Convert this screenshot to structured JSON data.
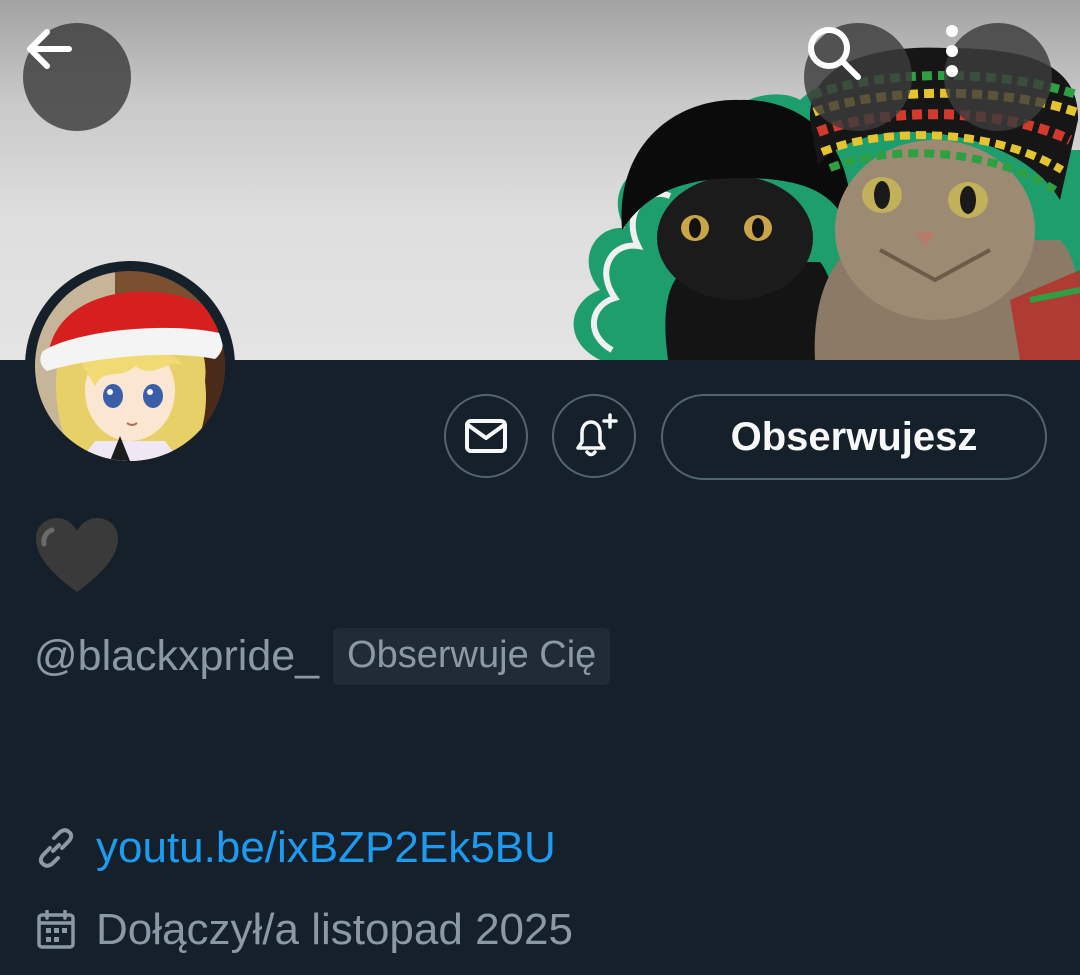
{
  "header": {
    "back_icon": "arrow-left-icon",
    "search_icon": "search-icon",
    "more_icon": "more-vertical-icon",
    "banner_background_color": "#dedede",
    "banner_accent_color": "#1f9e6d"
  },
  "profile": {
    "display_name_emoji": "🖤",
    "handle": "@blackxpride_",
    "follows_you_badge": "Obserwuje Cię",
    "link_icon": "link-icon",
    "link": "youtu.be/ixBZP2Ek5BU",
    "calendar_icon": "calendar-icon",
    "joined": "Dołączył/a listopad 2025"
  },
  "actions": {
    "message_icon": "mail-icon",
    "notify_icon": "bell-plus-icon",
    "follow_label": "Obserwujesz"
  },
  "colors": {
    "background": "#15202b",
    "primary_text": "#f7f9f9",
    "secondary_text": "#8b98a5",
    "link": "#1d9bf0",
    "border": "#536471"
  }
}
